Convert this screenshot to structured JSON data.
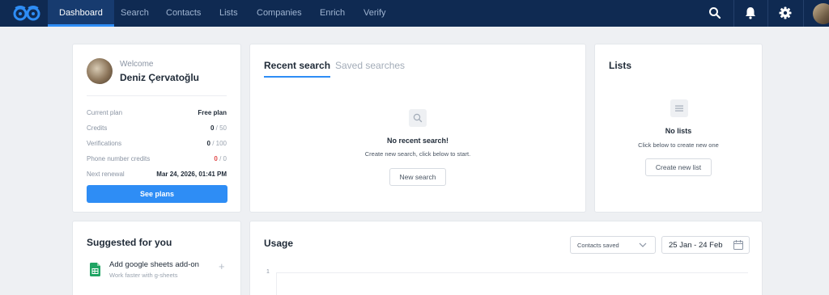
{
  "nav": {
    "items": [
      "Dashboard",
      "Search",
      "Contacts",
      "Lists",
      "Companies",
      "Enrich",
      "Verify"
    ],
    "active": "Dashboard",
    "icons": [
      "logo-icon",
      "search-icon",
      "bell-icon",
      "gear-icon",
      "avatar"
    ]
  },
  "profile": {
    "welcome": "Welcome",
    "name": "Deniz Çervatoğlu",
    "stats": [
      {
        "label": "Current plan",
        "value": "Free plan"
      },
      {
        "label": "Credits",
        "used": "0",
        "total": "/ 50"
      },
      {
        "label": "Verifications",
        "used": "0",
        "total": "/ 100"
      },
      {
        "label": "Phone number credits",
        "used": "0",
        "total": "/ 0"
      },
      {
        "label": "Next renewal",
        "value": "Mar 24, 2026, 01:41 PM"
      }
    ],
    "button": "See plans"
  },
  "recent": {
    "tabs": [
      "Recent search",
      "Saved searches"
    ],
    "empty_title": "No recent search!",
    "empty_sub": "Create new search, click below to start.",
    "button": "New search"
  },
  "lists": {
    "title": "Lists",
    "empty_title": "No lists",
    "empty_sub": "Click below to create new one",
    "button": "Create new list"
  },
  "suggested": {
    "title": "Suggested for you",
    "item_title": "Add google sheets add-on",
    "item_sub": "Work faster with g-sheets"
  },
  "usage": {
    "title": "Usage",
    "metric": "Contacts saved",
    "date_range": "25 Jan - 24 Feb",
    "y_tick": "1"
  },
  "colors": {
    "nav_bg": "#0f2a52",
    "accent": "#2e8df5",
    "error": "#e04848",
    "sheets_green": "#1fa463"
  }
}
